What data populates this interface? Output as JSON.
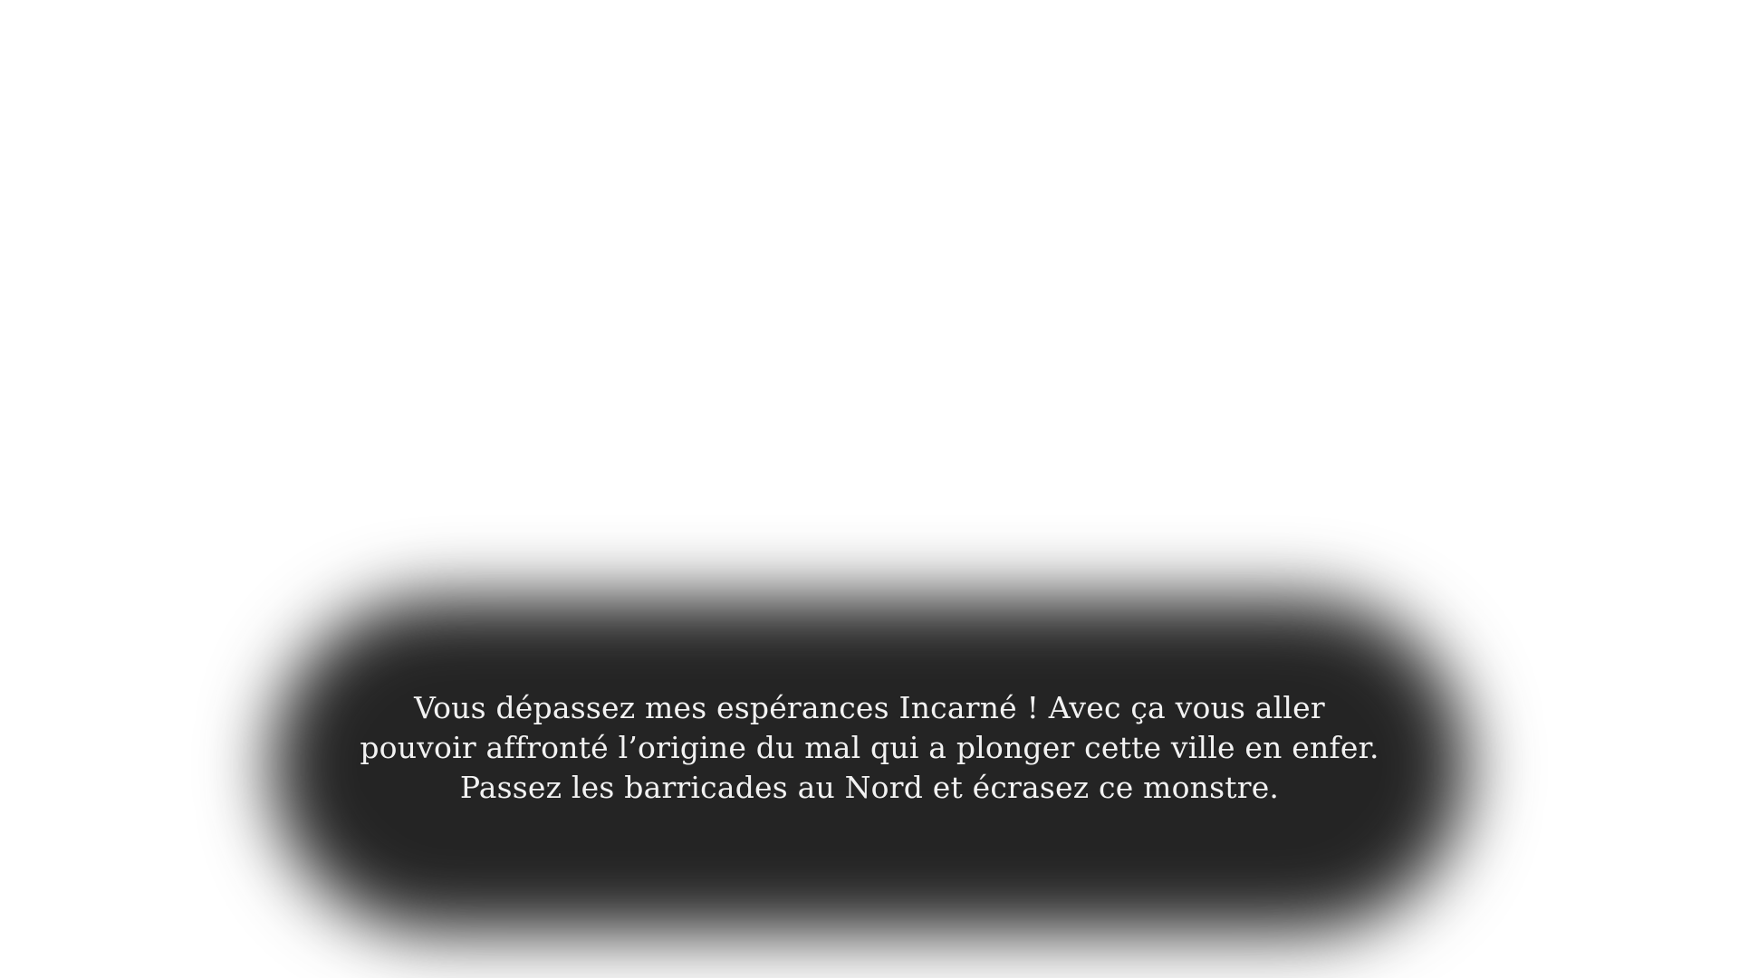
{
  "dialogue": {
    "lines": [
      "Vous dépassez mes espérances Incarné ! Avec ça vous aller",
      "pouvoir affronté l’origine du mal qui a plonger cette ville en enfer.",
      "Passez les barricades au Nord et écrasez ce monstre."
    ]
  },
  "colors": {
    "background": "#ffffff",
    "dialogue_panel": "#242424",
    "dialogue_text": "#f2f2f2"
  }
}
